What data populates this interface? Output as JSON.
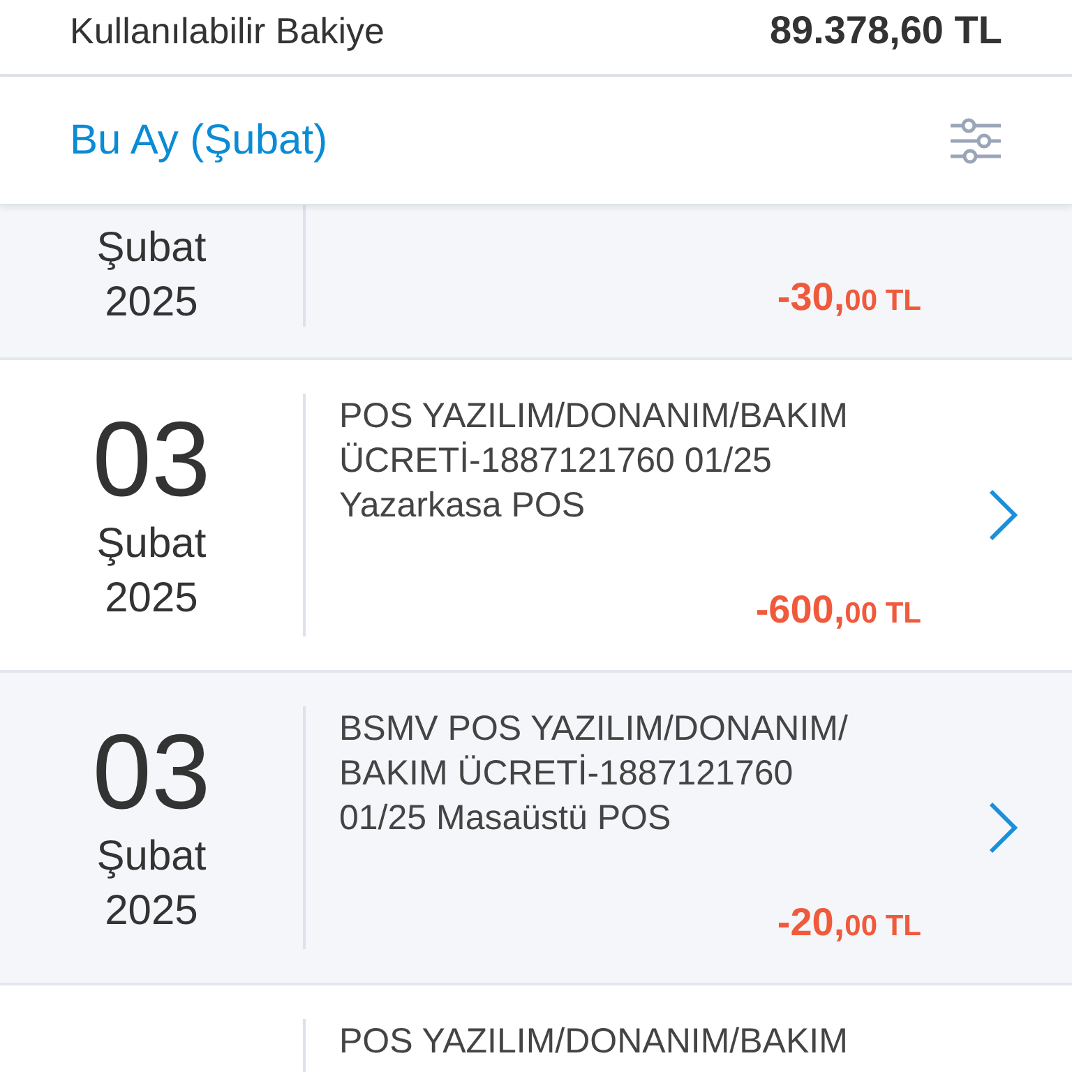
{
  "balance": {
    "label": "Kullanılabilir Bakiye",
    "amount": "89.378,60 TL"
  },
  "period": {
    "title": "Bu Ay (Şubat)"
  },
  "transactions": [
    {
      "month": "Şubat",
      "year": "2025",
      "amount_main": "-30,",
      "amount_fraction": "00 TL"
    },
    {
      "day": "03",
      "month": "Şubat",
      "year": "2025",
      "description": "POS YAZILIM/DONANIM/BAKIM\nÜCRETİ-1887121760 01/25\nYazarkasa POS",
      "amount_main": "-600,",
      "amount_fraction": "00 TL"
    },
    {
      "day": "03",
      "month": "Şubat",
      "year": "2025",
      "description": "BSMV POS YAZILIM/DONANIM/\nBAKIM ÜCRETİ-1887121760\n01/25 Masaüstü POS",
      "amount_main": "-20,",
      "amount_fraction": "00 TL"
    },
    {
      "description": "POS YAZILIM/DONANIM/BAKIM"
    }
  ]
}
